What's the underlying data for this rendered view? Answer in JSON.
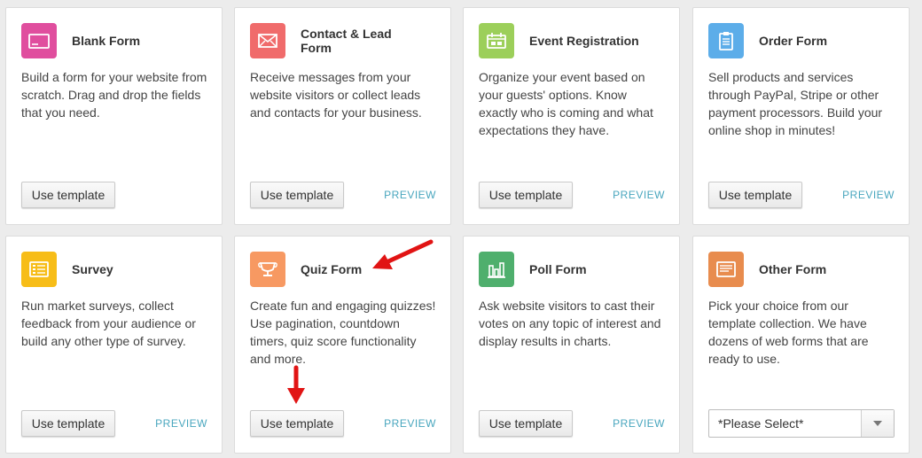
{
  "cards": [
    {
      "title": "Blank Form",
      "desc": "Build a form for your website from scratch. Drag and drop the fields that you need.",
      "button": "Use template",
      "icon": "blank-form-icon",
      "color": "#e04e9e"
    },
    {
      "title": "Contact & Lead Form",
      "desc": "Receive messages from your website visitors or collect leads and contacts for your business.",
      "button": "Use template",
      "preview": "PREVIEW",
      "icon": "envelope-icon",
      "color": "#f06b6b"
    },
    {
      "title": "Event Registration",
      "desc": "Organize your event based on your guests' options. Know exactly who is coming and what expectations they have.",
      "button": "Use template",
      "preview": "PREVIEW",
      "icon": "ticket-icon",
      "color": "#9ccf5a"
    },
    {
      "title": "Order Form",
      "desc": "Sell products and services through PayPal, Stripe or other payment processors. Build your online shop in minutes!",
      "button": "Use template",
      "preview": "PREVIEW",
      "icon": "clipboard-icon",
      "color": "#5cade9"
    },
    {
      "title": "Survey",
      "desc": "Run market surveys, collect feedback from your audience or build any other type of survey.",
      "button": "Use template",
      "preview": "PREVIEW",
      "icon": "survey-list-icon",
      "color": "#f7bd18"
    },
    {
      "title": "Quiz Form",
      "desc": "Create fun and engaging quizzes! Use pagination, countdown timers, quiz score functionality and more.",
      "button": "Use template",
      "preview": "PREVIEW",
      "icon": "trophy-icon",
      "color": "#f79962"
    },
    {
      "title": "Poll Form",
      "desc": "Ask website visitors to cast their votes on any topic of interest and display results in charts.",
      "button": "Use template",
      "preview": "PREVIEW",
      "icon": "bar-chart-icon",
      "color": "#4faf6d"
    },
    {
      "title": "Other Form",
      "desc": "Pick your choice from our template collection. We have dozens of web forms that are ready to use.",
      "select_value": "*Please Select*",
      "icon": "document-icon",
      "color": "#e88c4e"
    }
  ],
  "annotation_color": "#e11414"
}
